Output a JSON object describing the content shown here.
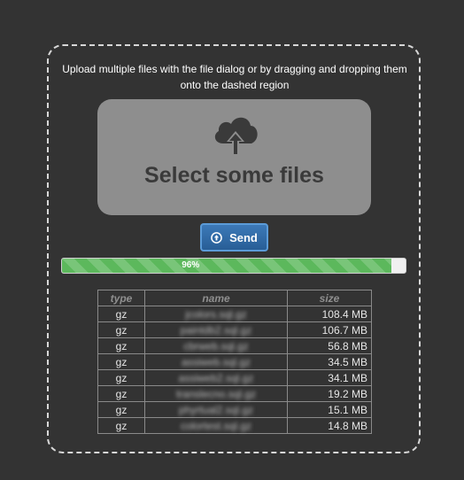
{
  "instructions": "Upload multiple files with the file dialog or by dragging and dropping them onto the dashed region",
  "select_label": "Select some files",
  "send_label": "Send",
  "progress": {
    "percent": 96,
    "label": "96%",
    "color": "#5cb85c"
  },
  "icons": {
    "upload": "cloud-upload-icon",
    "send": "circle-arrow-up-icon"
  },
  "table": {
    "headers": [
      "type",
      "name",
      "size"
    ],
    "rows": [
      {
        "type": "gz",
        "name": "jcolors.sql.gz",
        "size": "108.4 MB"
      },
      {
        "type": "gz",
        "name": "paintdb2.sql.gz",
        "size": "106.7 MB"
      },
      {
        "type": "gz",
        "name": "cbrweb.sql.gz",
        "size": "56.8 MB"
      },
      {
        "type": "gz",
        "name": "assiweb.sql.gz",
        "size": "34.5 MB"
      },
      {
        "type": "gz",
        "name": "assiweb2.sql.gz",
        "size": "34.1 MB"
      },
      {
        "type": "gz",
        "name": "translecno.sql.gz",
        "size": "19.2 MB"
      },
      {
        "type": "gz",
        "name": "phyrtual2.sql.gz",
        "size": "15.1 MB"
      },
      {
        "type": "gz",
        "name": "colortest.sql.gz",
        "size": "14.8 MB"
      }
    ]
  }
}
